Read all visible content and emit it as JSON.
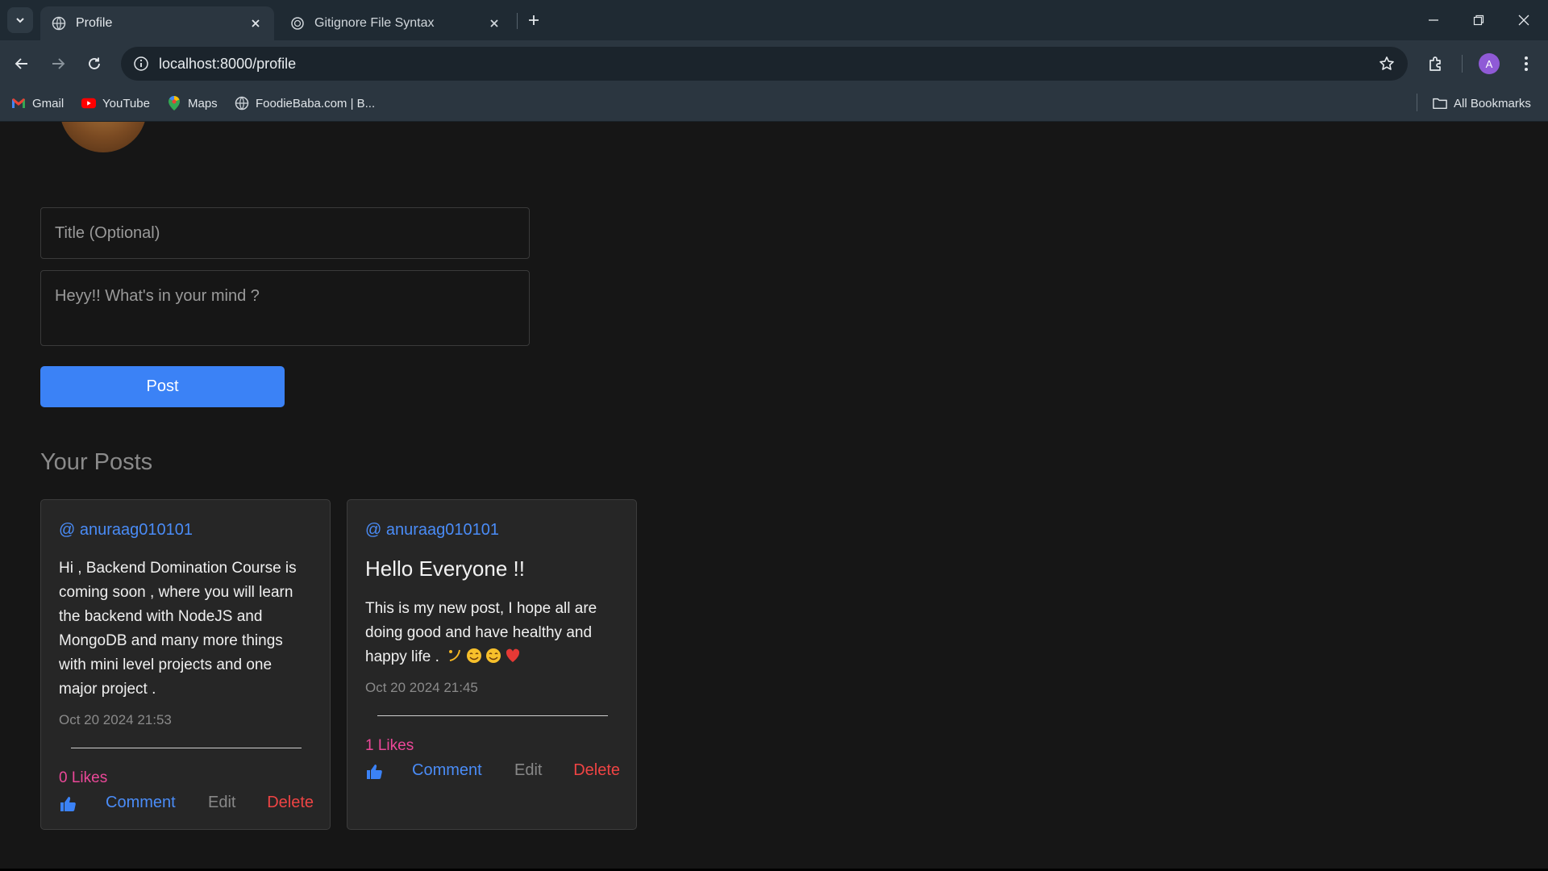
{
  "browser": {
    "tabs": [
      {
        "label": "Profile",
        "active": true
      },
      {
        "label": "Gitignore File Syntax",
        "active": false
      }
    ],
    "url": "localhost:8000/profile",
    "profile_initial": "A",
    "bookmarks": [
      {
        "label": "Gmail"
      },
      {
        "label": "YouTube"
      },
      {
        "label": "Maps"
      },
      {
        "label": "FoodieBaba.com | B..."
      }
    ],
    "all_bookmarks": "All Bookmarks"
  },
  "form": {
    "title_placeholder": "Title (Optional)",
    "body_placeholder": "Heyy!! What's in your mind ?",
    "post_label": "Post"
  },
  "section_title": "Your Posts",
  "posts": [
    {
      "author": "@ anuraag010101",
      "title": "",
      "body": "Hi , Backend Domination Course is coming soon , where you will learn the backend with NodeJS and MongoDB and many more things with mini level projects and one major project .",
      "date": "Oct 20 2024 21:53",
      "likes": "0 Likes",
      "comment": "Comment",
      "edit": "Edit",
      "delete": "Delete"
    },
    {
      "author": "@ anuraag010101",
      "title": "Hello Everyone !!",
      "body": "This is my new post, I hope all are doing good and have healthy and happy life .",
      "date": "Oct 20 2024 21:45",
      "likes": "1 Likes",
      "comment": "Comment",
      "edit": "Edit",
      "delete": "Delete"
    }
  ],
  "colors": {
    "accent": "#3b82f6",
    "likes": "#ec4899",
    "delete": "#ef4444"
  }
}
